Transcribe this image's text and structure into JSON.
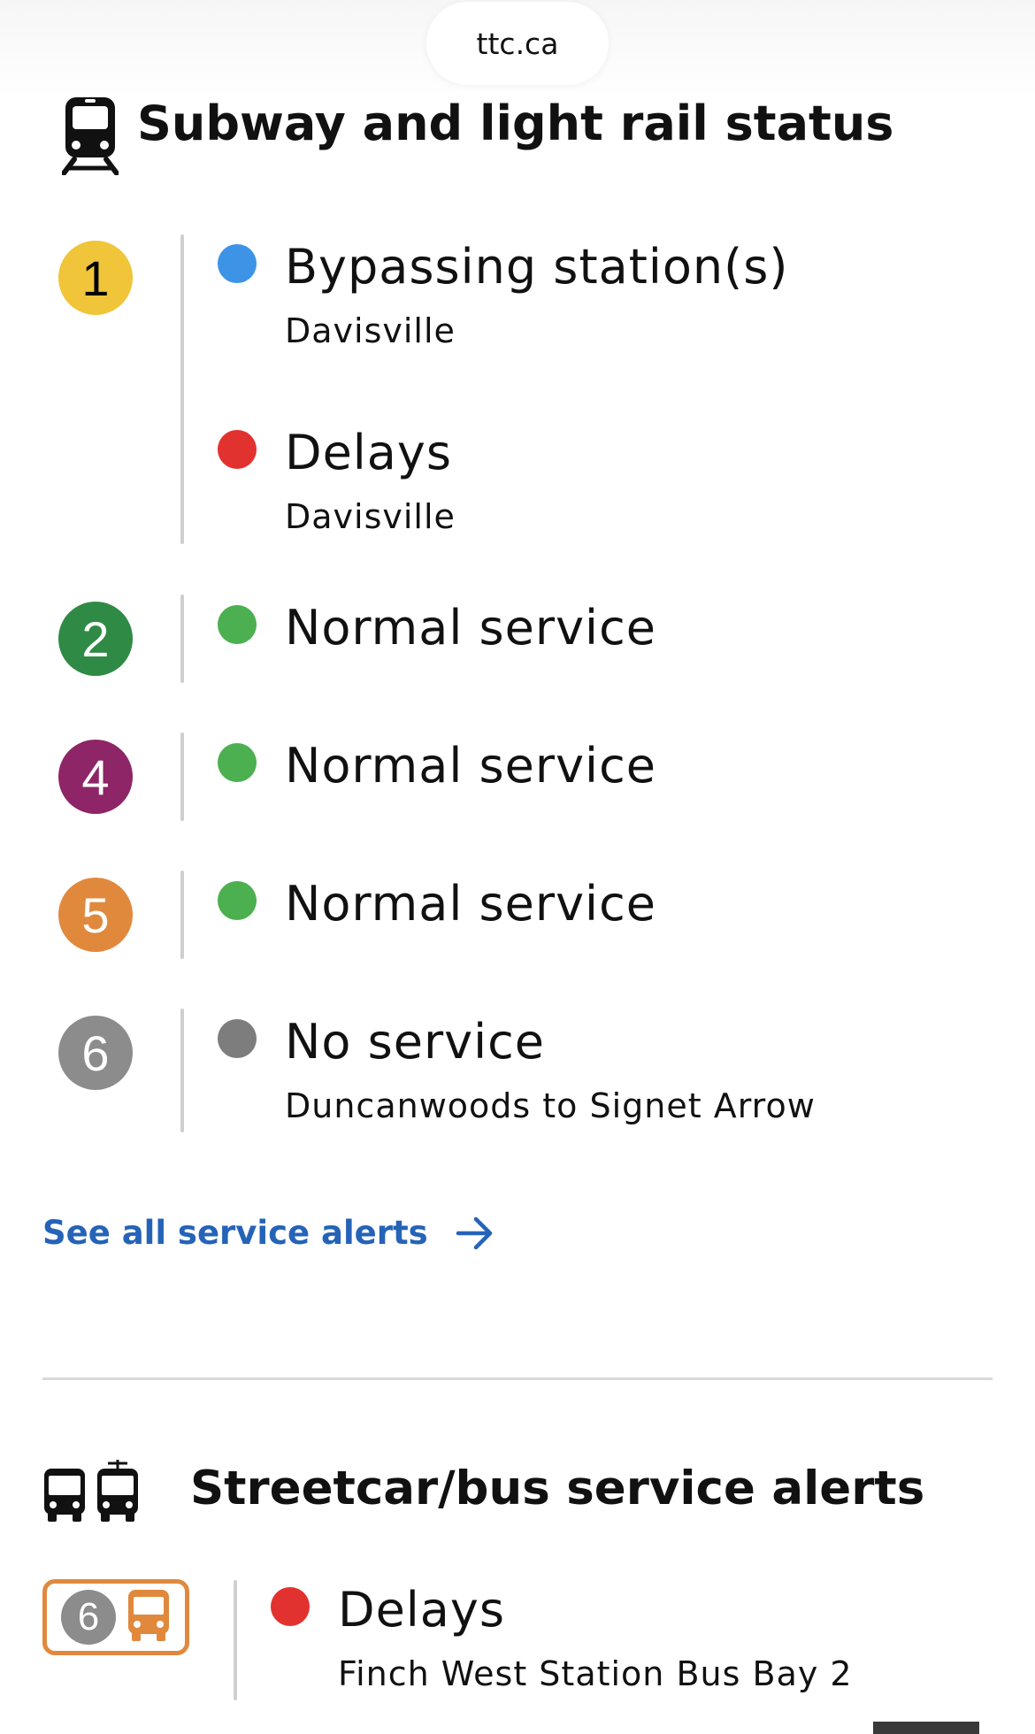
{
  "browser": {
    "url": "ttc.ca"
  },
  "subway": {
    "title": "Subway and light rail status",
    "icon": "subway-train-icon",
    "lines": [
      {
        "number": "1",
        "color": "#f0c53a",
        "number_color": "#000000",
        "statuses": [
          {
            "label": "Bypassing station(s)",
            "detail": "Davisville",
            "dot_color": "#3d93e6"
          },
          {
            "label": "Delays",
            "detail": "Davisville",
            "dot_color": "#e2322f"
          }
        ]
      },
      {
        "number": "2",
        "color": "#2f8a45",
        "number_color": "#ffffff",
        "statuses": [
          {
            "label": "Normal service",
            "dot_color": "#4caf50"
          }
        ]
      },
      {
        "number": "4",
        "color": "#8e2566",
        "number_color": "#ffffff",
        "statuses": [
          {
            "label": "Normal service",
            "dot_color": "#4caf50"
          }
        ]
      },
      {
        "number": "5",
        "color": "#e0893d",
        "number_color": "#ffffff",
        "statuses": [
          {
            "label": "Normal service",
            "dot_color": "#4caf50"
          }
        ]
      },
      {
        "number": "6",
        "color": "#8c8c8c",
        "number_color": "#ffffff",
        "statuses": [
          {
            "label": "No service",
            "detail": "Duncanwoods to Signet Arrow",
            "dot_color": "#7d7d7d"
          }
        ]
      }
    ],
    "see_all_label": "See all service alerts",
    "link_color": "#2563b8"
  },
  "surface": {
    "title": "Streetcar/bus service alerts",
    "icons": [
      "bus-icon",
      "streetcar-icon"
    ],
    "alerts": [
      {
        "route": "6",
        "route_icon": "bus-icon",
        "route_color": "#e0893d",
        "label": "Delays",
        "detail": "Finch West Station Bus Bay 2",
        "dot_color": "#e2322f"
      }
    ]
  }
}
